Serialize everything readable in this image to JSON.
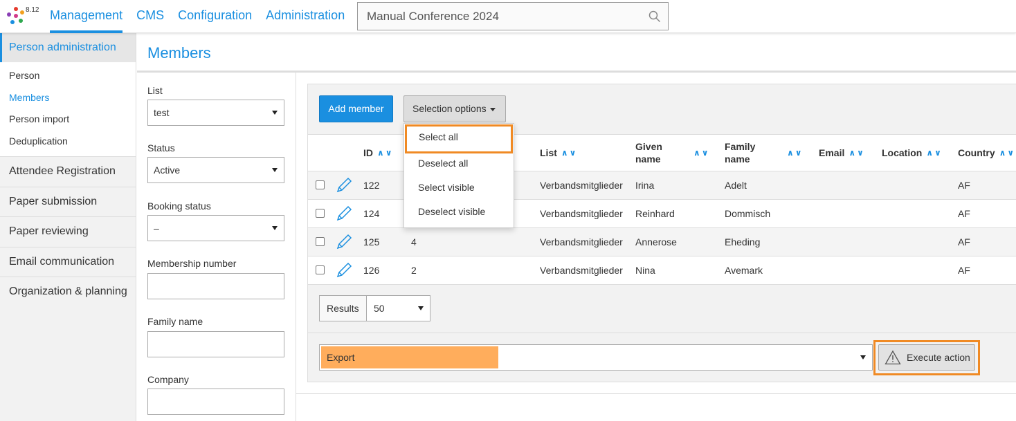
{
  "app": {
    "version": "8.12"
  },
  "topnav": {
    "tabs": [
      {
        "label": "Management",
        "active": true
      },
      {
        "label": "CMS"
      },
      {
        "label": "Configuration"
      },
      {
        "label": "Administration"
      }
    ],
    "search_value": "Manual Conference 2024",
    "search_icon": "search-icon"
  },
  "sidebar": {
    "active_section": "Person administration",
    "sub_items": [
      {
        "label": "Person"
      },
      {
        "label": "Members",
        "active": true
      },
      {
        "label": "Person import"
      },
      {
        "label": "Deduplication"
      }
    ],
    "sections": [
      "Attendee Registration",
      "Paper submission",
      "Paper reviewing",
      "Email communication",
      "Organization & planning"
    ]
  },
  "page": {
    "title": "Members"
  },
  "filters": {
    "list_label": "List",
    "list_value": "test",
    "status_label": "Status",
    "status_value": "Active",
    "booking_label": "Booking status",
    "booking_value": "–",
    "membership_label": "Membership number",
    "family_label": "Family name",
    "company_label": "Company"
  },
  "toolbar": {
    "add_label": "Add member",
    "selection_label": "Selection options"
  },
  "selection_menu": {
    "items": [
      "Select all",
      "Deselect all",
      "Select visible",
      "Deselect visible"
    ],
    "highlighted": "Select all"
  },
  "table": {
    "headers": {
      "id": "ID",
      "list": "List",
      "given_1": "Given",
      "given_2": "name",
      "family_1": "Family",
      "family_2": "name",
      "email": "Email",
      "location": "Location",
      "country": "Country"
    },
    "sort_glyph": "^v",
    "rows": [
      {
        "id": "122",
        "col": "",
        "list": "Verbandsmitglieder",
        "given": "Irina",
        "family": "Adelt",
        "country": "AF"
      },
      {
        "id": "124",
        "col": "",
        "list": "Verbandsmitglieder",
        "given": "Reinhard",
        "family": "Dommisch",
        "country": "AF"
      },
      {
        "id": "125",
        "col": "4",
        "list": "Verbandsmitglieder",
        "given": "Annerose",
        "family": "Eheding",
        "country": "AF"
      },
      {
        "id": "126",
        "col": "2",
        "list": "Verbandsmitglieder",
        "given": "Nina",
        "family": "Avemark",
        "country": "AF"
      }
    ]
  },
  "results": {
    "label": "Results",
    "value": "50"
  },
  "action": {
    "value": "Export",
    "execute_label": "Execute action"
  },
  "colors": {
    "accent": "#1a8fe0",
    "highlight": "#f08a24",
    "export_fill": "#ffad5c"
  }
}
